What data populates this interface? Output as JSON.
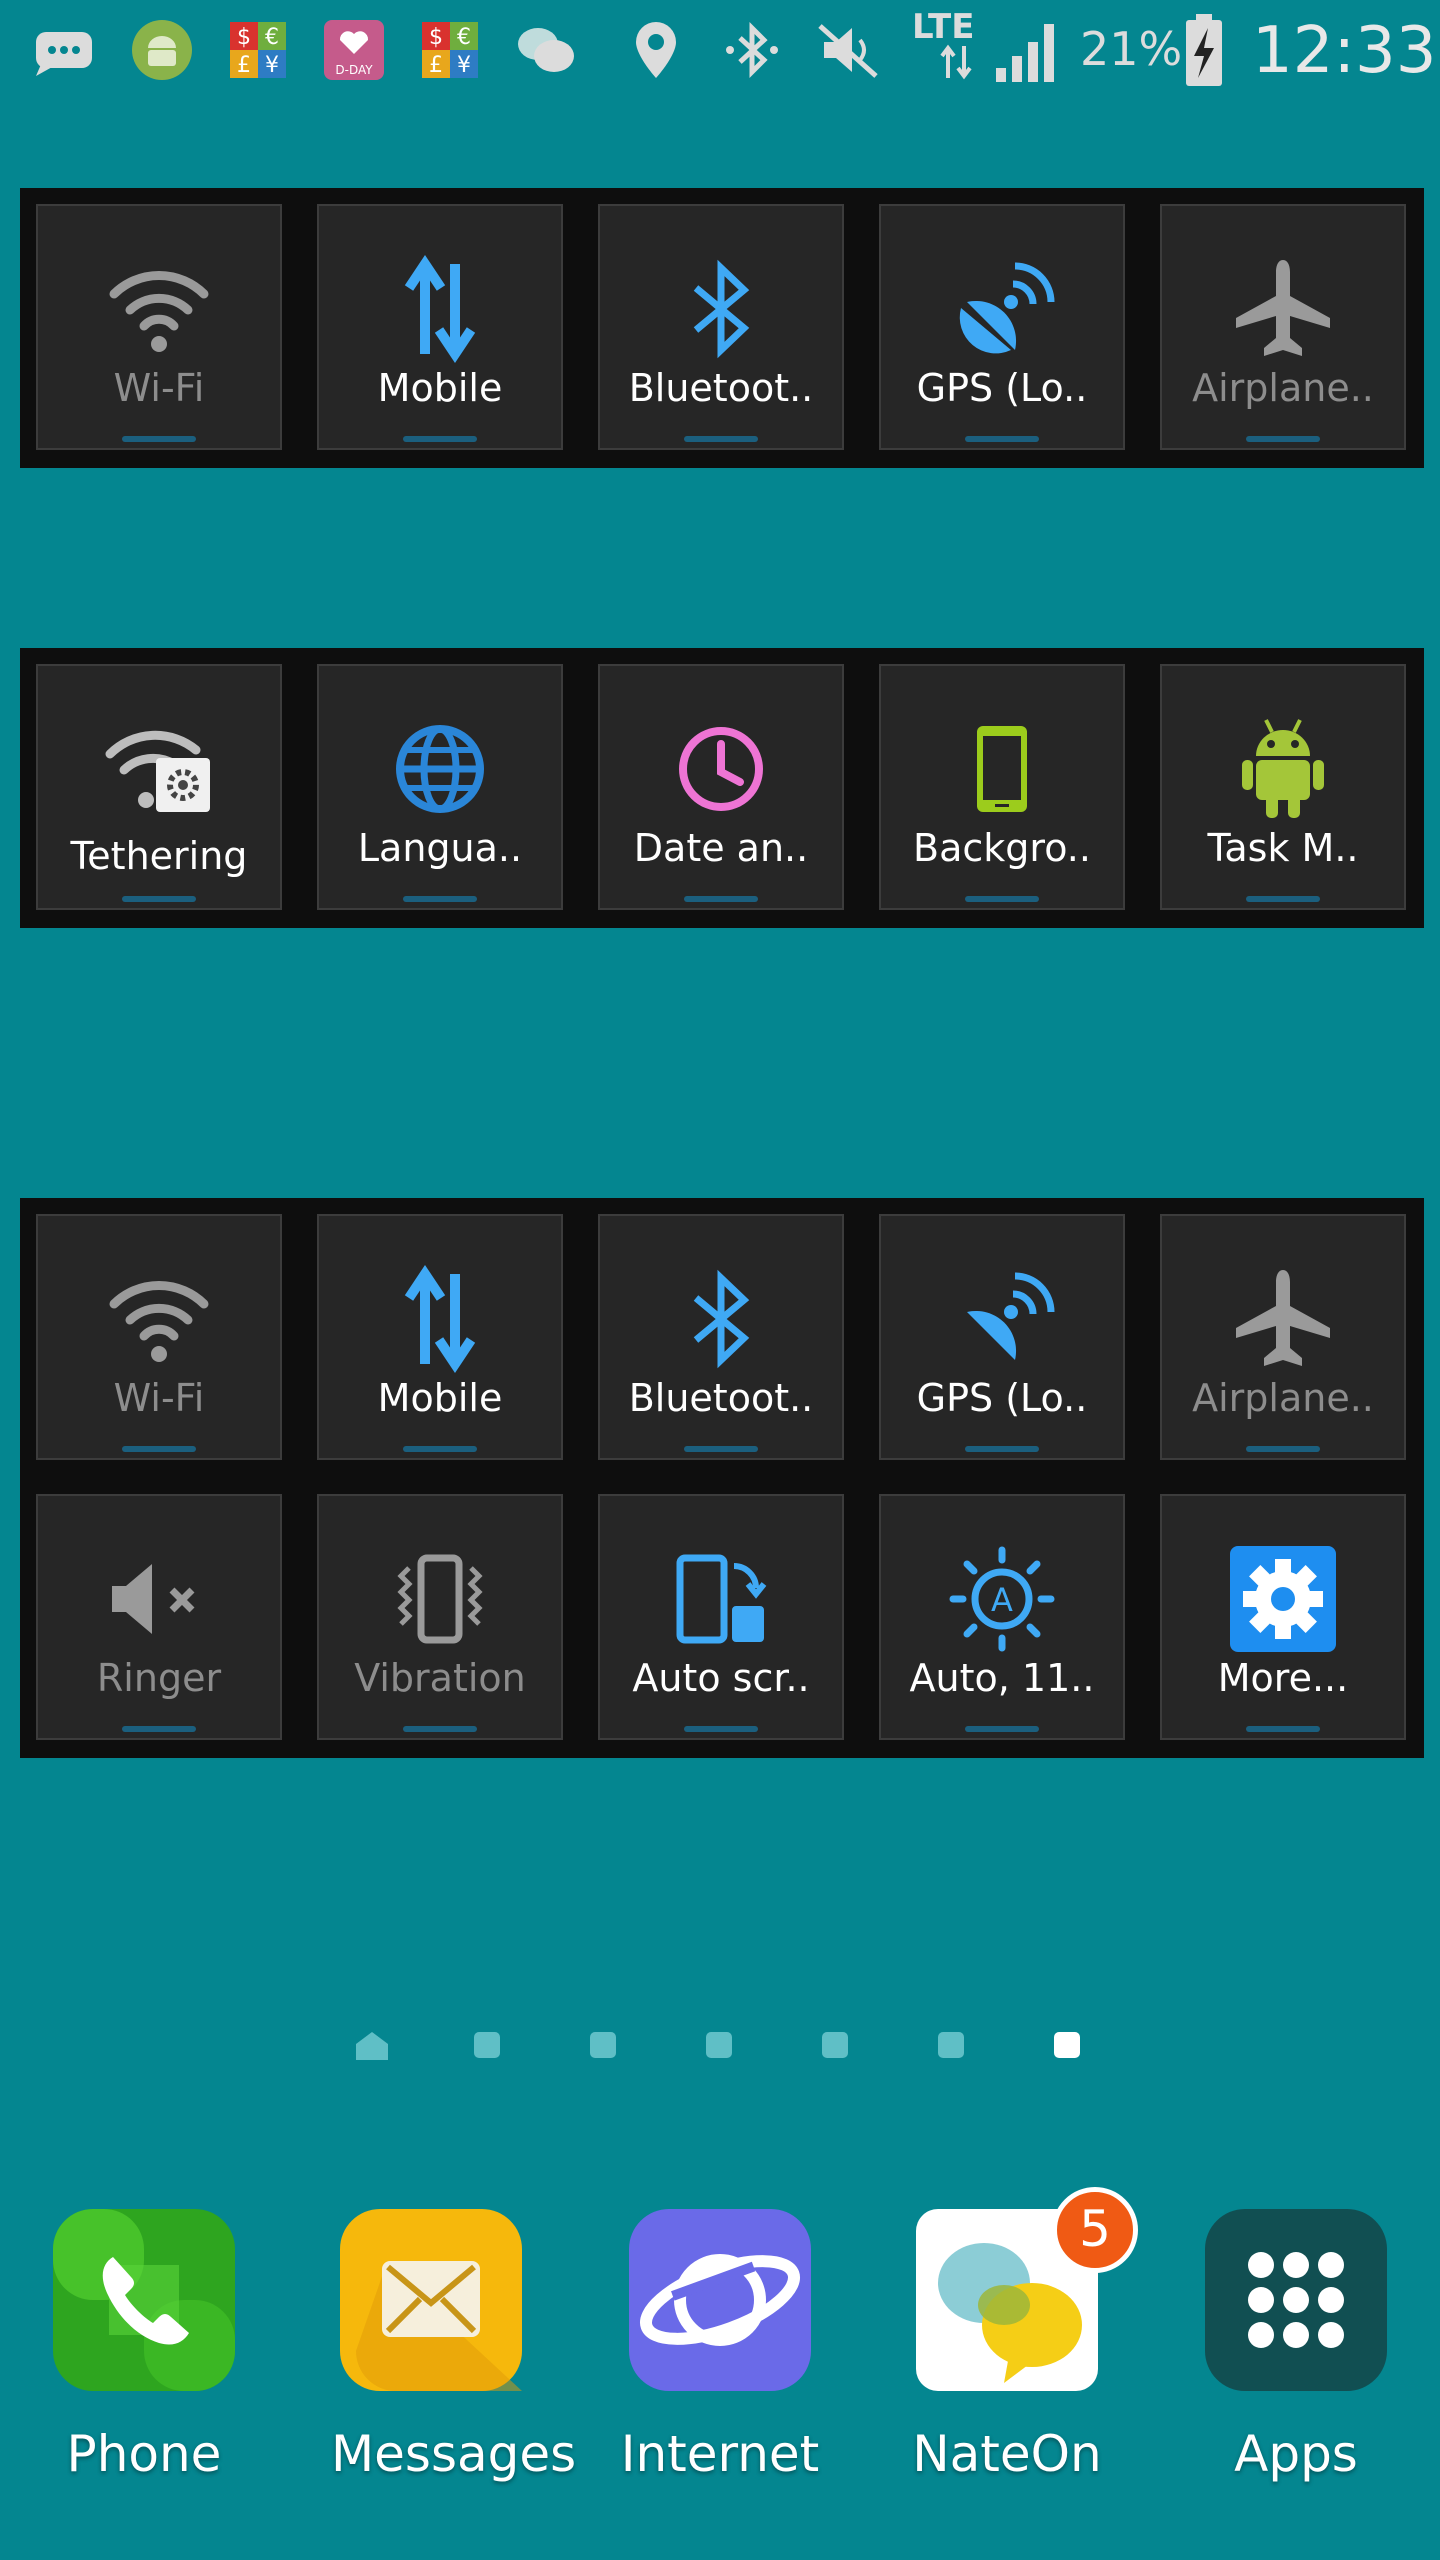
{
  "status_bar": {
    "network": "LTE",
    "battery_percent": "21%",
    "time": "12:33",
    "icons": [
      "chat-bubble-icon",
      "android-icon",
      "currency-icon",
      "dday-icon",
      "currency-icon",
      "talk-icon",
      "location-icon",
      "bluetooth-icon",
      "mute-icon",
      "lte-icon",
      "signal-icon",
      "battery-charging-icon"
    ],
    "dday_text": "D-DAY",
    "currency_symbols": [
      "$",
      "€",
      "£",
      "¥"
    ]
  },
  "widget_top": {
    "tiles": [
      {
        "label": "Wi-Fi",
        "icon": "wifi-icon",
        "state": "off"
      },
      {
        "label": "Mobile",
        "icon": "mobile-data-icon",
        "state": "on"
      },
      {
        "label": "Bluetoot..",
        "icon": "bluetooth-icon",
        "state": "on"
      },
      {
        "label": "GPS (Lo..",
        "icon": "gps-icon",
        "state": "on"
      },
      {
        "label": "Airplane..",
        "icon": "airplane-icon",
        "state": "off"
      }
    ]
  },
  "widget_middle": {
    "tiles": [
      {
        "label": "Tethering",
        "icon": "tethering-icon",
        "state": "on"
      },
      {
        "label": "Langua..",
        "icon": "globe-icon",
        "state": "on"
      },
      {
        "label": "Date an..",
        "icon": "clock-icon",
        "state": "on"
      },
      {
        "label": "Backgro..",
        "icon": "phone-icon",
        "state": "on"
      },
      {
        "label": "Task M..",
        "icon": "android-icon",
        "state": "on"
      }
    ]
  },
  "widget_bottom": {
    "row1": [
      {
        "label": "Wi-Fi",
        "icon": "wifi-icon",
        "state": "off"
      },
      {
        "label": "Mobile",
        "icon": "mobile-data-icon",
        "state": "on"
      },
      {
        "label": "Bluetoot..",
        "icon": "bluetooth-icon",
        "state": "on"
      },
      {
        "label": "GPS (Lo..",
        "icon": "gps-icon",
        "state": "on"
      },
      {
        "label": "Airplane..",
        "icon": "airplane-icon",
        "state": "off"
      }
    ],
    "row2": [
      {
        "label": "Ringer",
        "icon": "ringer-mute-icon",
        "state": "off"
      },
      {
        "label": "Vibration",
        "icon": "vibration-icon",
        "state": "off"
      },
      {
        "label": "Auto scr..",
        "icon": "auto-rotate-icon",
        "state": "on"
      },
      {
        "label": "Auto, 11..",
        "icon": "brightness-icon",
        "state": "on"
      },
      {
        "label": "More...",
        "icon": "settings-gear-icon",
        "state": "on"
      }
    ]
  },
  "pager": {
    "count": 7,
    "active_index": 6,
    "home_index": 0
  },
  "dock": [
    {
      "label": "Phone",
      "icon": "phone-app-icon"
    },
    {
      "label": "Messages",
      "icon": "messages-app-icon"
    },
    {
      "label": "Internet",
      "icon": "internet-app-icon"
    },
    {
      "label": "NateOn",
      "icon": "nateon-app-icon",
      "badge": "5"
    },
    {
      "label": "Apps",
      "icon": "apps-grid-icon"
    }
  ],
  "colors": {
    "background": "#048690",
    "accent_blue": "#3fa9f5",
    "off_gray": "#8d8d8d",
    "clock_pink": "#ee74d4",
    "phone_green": "#9ccc1c",
    "badge_orange": "#f05a14"
  }
}
